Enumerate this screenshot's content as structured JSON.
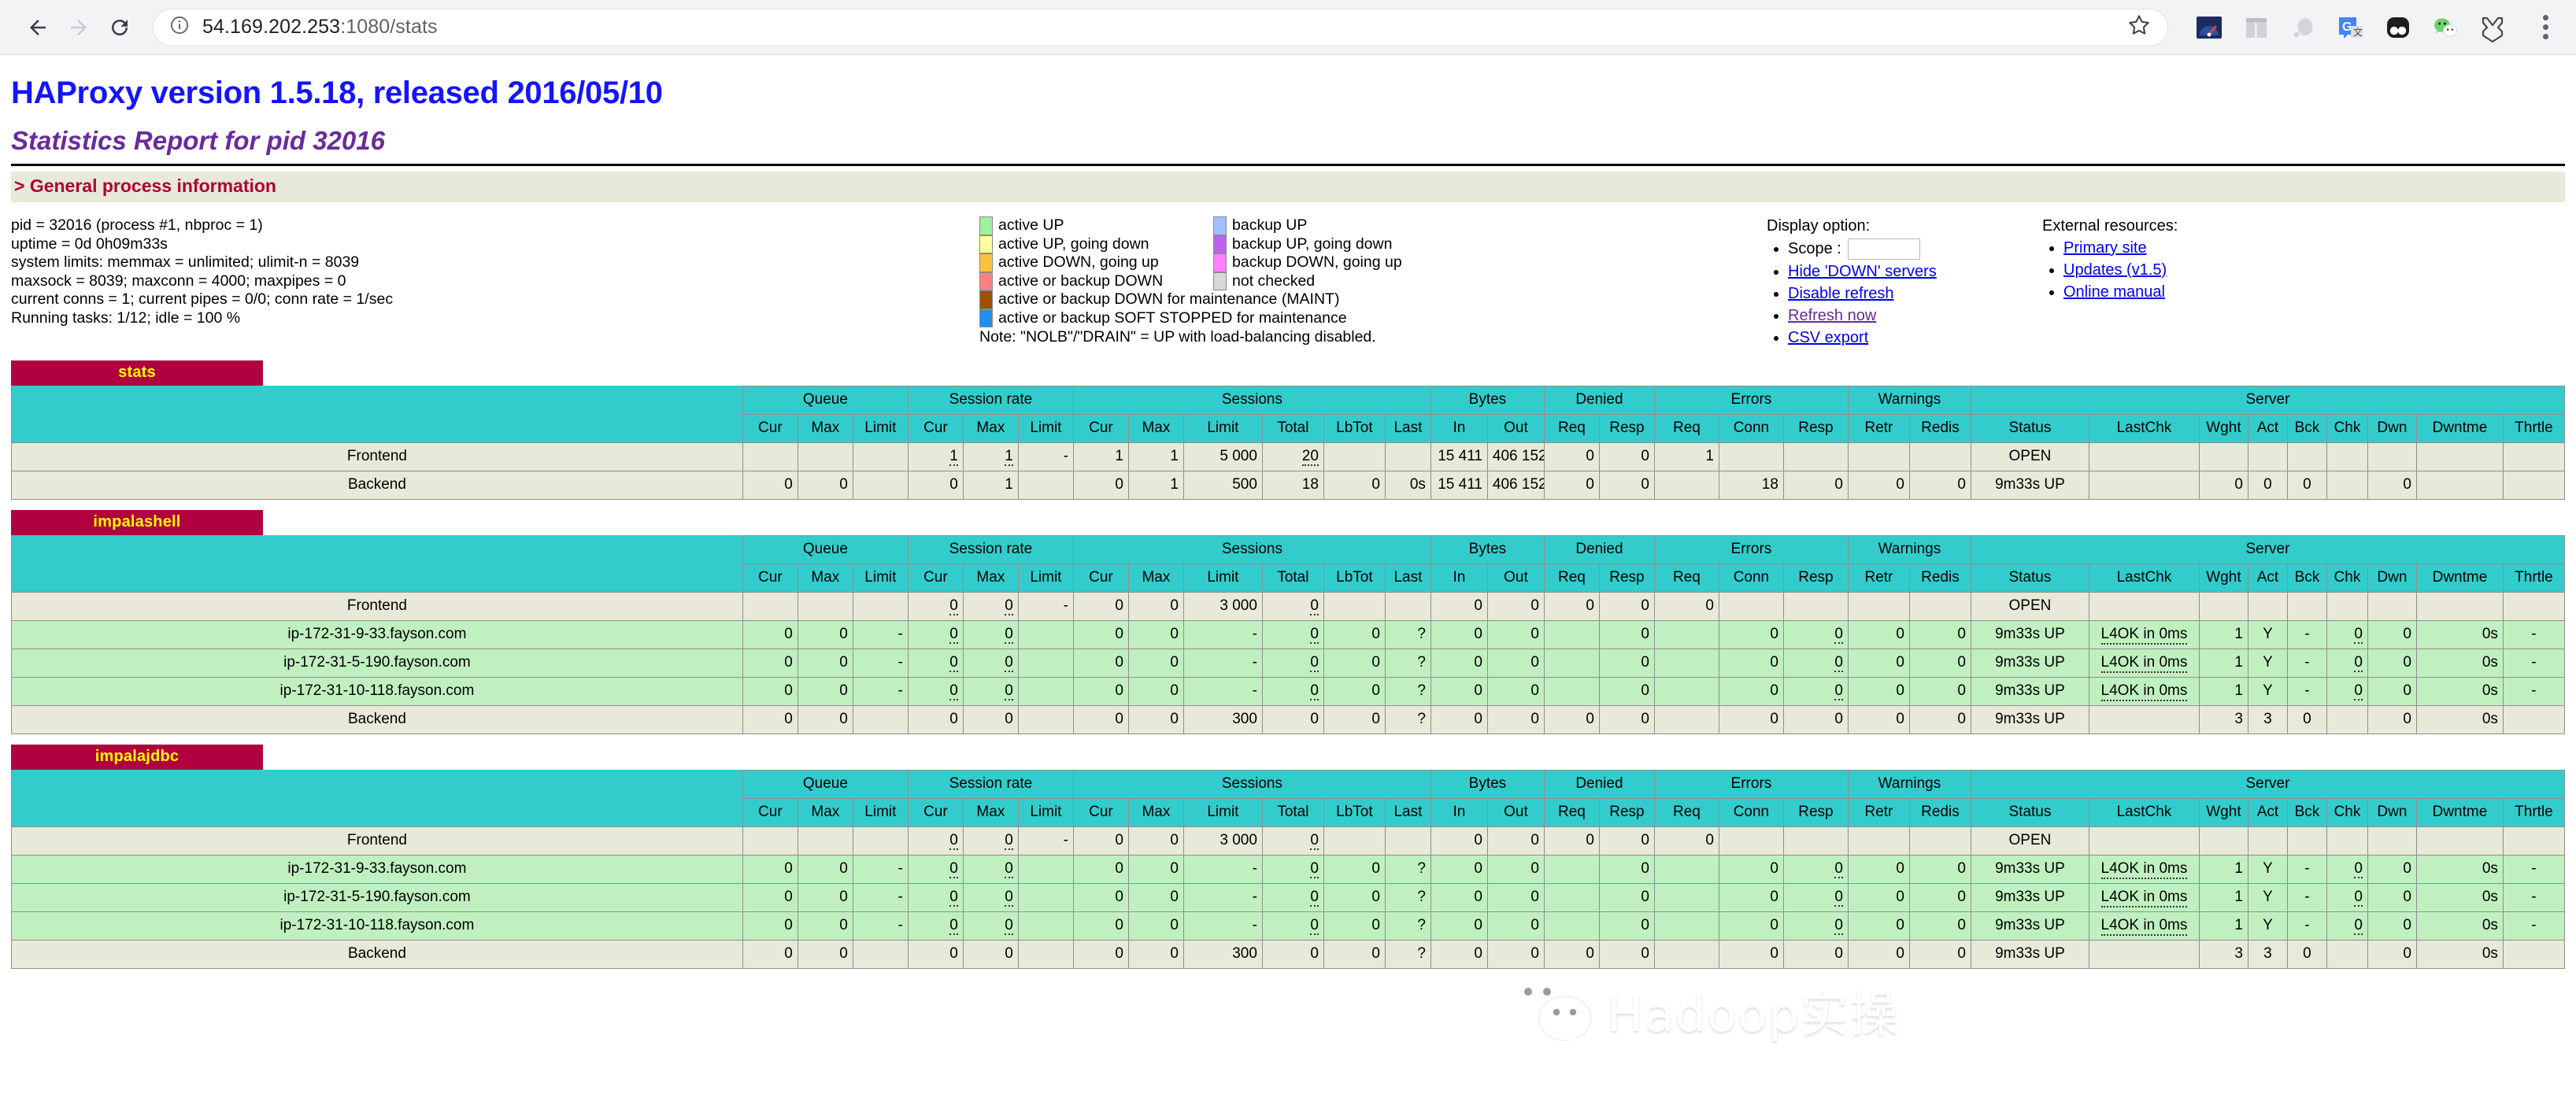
{
  "browser": {
    "url_host": "54.169.202.253",
    "url_path": ":1080/stats",
    "back_icon": "back-arrow-icon",
    "forward_icon": "forward-arrow-icon",
    "reload_icon": "reload-icon",
    "info_icon": "info-circle-icon",
    "bookmark_icon": "star-icon",
    "menu_icon": "kebab-menu-icon"
  },
  "header": {
    "title": "HAProxy version 1.5.18, released 2016/05/10",
    "subtitle": "Statistics Report for pid 32016",
    "section_title": "> General process information"
  },
  "process_info": [
    "pid = 32016 (process #1, nbproc = 1)",
    "uptime = 0d 0h09m33s",
    "system limits: memmax = unlimited; ulimit-n = 8039",
    "maxsock = 8039; maxconn = 4000; maxpipes = 0",
    "current conns = 1; current pipes = 0/0; conn rate = 1/sec",
    "Running tasks: 1/12; idle = 100 %"
  ],
  "legend": {
    "left": [
      {
        "label": "active UP",
        "color": "#a0f0a0"
      },
      {
        "label": "active UP, going down",
        "color": "#ffffa0"
      },
      {
        "label": "active DOWN, going up",
        "color": "#ffc040"
      },
      {
        "label": "active or backup DOWN",
        "color": "#ff8080"
      }
    ],
    "right": [
      {
        "label": "backup UP",
        "color": "#a0c0ff"
      },
      {
        "label": "backup UP, going down",
        "color": "#c060f0"
      },
      {
        "label": "backup DOWN, going up",
        "color": "#ff80ff"
      },
      {
        "label": "not checked",
        "color": "#d8d8d8"
      }
    ],
    "wide": [
      {
        "label": "active or backup DOWN for maintenance (MAINT)",
        "color": "#a05000"
      },
      {
        "label": "active or backup SOFT STOPPED for maintenance",
        "color": "#2090f0"
      }
    ],
    "note": "Note: \"NOLB\"/\"DRAIN\" = UP with load-balancing disabled."
  },
  "display_options": {
    "heading": "Display option:",
    "scope_label": "Scope :",
    "scope_value": "",
    "links": [
      {
        "label": "Hide 'DOWN' servers",
        "visited": false
      },
      {
        "label": "Disable refresh",
        "visited": false
      },
      {
        "label": "Refresh now",
        "visited": true
      },
      {
        "label": "CSV export",
        "visited": false
      }
    ]
  },
  "external_resources": {
    "heading": "External resources:",
    "links": [
      "Primary site",
      "Updates (v1.5)",
      "Online manual"
    ]
  },
  "table_headers": {
    "groups": [
      "Queue",
      "Session rate",
      "Sessions",
      "Bytes",
      "Denied",
      "Errors",
      "Warnings",
      "Server"
    ],
    "queue": [
      "Cur",
      "Max",
      "Limit"
    ],
    "session_rate": [
      "Cur",
      "Max",
      "Limit"
    ],
    "sessions": [
      "Cur",
      "Max",
      "Limit",
      "Total",
      "LbTot",
      "Last"
    ],
    "bytes": [
      "In",
      "Out"
    ],
    "denied": [
      "Req",
      "Resp"
    ],
    "errors": [
      "Req",
      "Conn",
      "Resp"
    ],
    "warnings": [
      "Retr",
      "Redis"
    ],
    "server": [
      "Status",
      "LastChk",
      "Wght",
      "Act",
      "Bck",
      "Chk",
      "Dwn",
      "Dwntme",
      "Thrtle"
    ]
  },
  "proxies": [
    {
      "name": "stats",
      "rows": [
        {
          "type": "frontend",
          "name": "Frontend",
          "q_cur": "",
          "q_max": "",
          "q_limit": "",
          "sr_cur": "1",
          "sr_max": "1",
          "sr_limit": "-",
          "s_cur": "1",
          "s_max": "1",
          "s_limit": "5 000",
          "s_total": "20",
          "s_lbtot": "",
          "s_last": "",
          "b_in": "15 411",
          "b_out": "406 152",
          "d_req": "0",
          "d_resp": "0",
          "e_req": "1",
          "e_conn": "",
          "e_resp": "",
          "w_retr": "",
          "w_redis": "",
          "status": "OPEN",
          "lastchk": "",
          "wght": "",
          "act": "",
          "bck": "",
          "chk": "",
          "dwn": "",
          "dwntme": "",
          "thrtle": ""
        },
        {
          "type": "backend",
          "name": "Backend",
          "q_cur": "0",
          "q_max": "0",
          "q_limit": "",
          "sr_cur": "0",
          "sr_max": "1",
          "sr_limit": "",
          "s_cur": "0",
          "s_max": "1",
          "s_limit": "500",
          "s_total": "18",
          "s_lbtot": "0",
          "s_last": "0s",
          "b_in": "15 411",
          "b_out": "406 152",
          "d_req": "0",
          "d_resp": "0",
          "e_req": "",
          "e_conn": "18",
          "e_resp": "0",
          "w_retr": "0",
          "w_redis": "0",
          "status": "9m33s UP",
          "lastchk": "",
          "wght": "0",
          "act": "0",
          "bck": "0",
          "chk": "",
          "dwn": "0",
          "dwntme": "",
          "thrtle": ""
        }
      ]
    },
    {
      "name": "impalashell",
      "rows": [
        {
          "type": "frontend",
          "name": "Frontend",
          "q_cur": "",
          "q_max": "",
          "q_limit": "",
          "sr_cur": "0",
          "sr_max": "0",
          "sr_limit": "-",
          "s_cur": "0",
          "s_max": "0",
          "s_limit": "3 000",
          "s_total": "0",
          "s_lbtot": "",
          "s_last": "",
          "b_in": "0",
          "b_out": "0",
          "d_req": "0",
          "d_resp": "0",
          "e_req": "0",
          "e_conn": "",
          "e_resp": "",
          "w_retr": "",
          "w_redis": "",
          "status": "OPEN",
          "lastchk": "",
          "wght": "",
          "act": "",
          "bck": "",
          "chk": "",
          "dwn": "",
          "dwntme": "",
          "thrtle": ""
        },
        {
          "type": "server",
          "name": "ip-172-31-9-33.fayson.com",
          "q_cur": "0",
          "q_max": "0",
          "q_limit": "-",
          "sr_cur": "0",
          "sr_max": "0",
          "sr_limit": "",
          "s_cur": "0",
          "s_max": "0",
          "s_limit": "-",
          "s_total": "0",
          "s_lbtot": "0",
          "s_last": "?",
          "b_in": "0",
          "b_out": "0",
          "d_req": "",
          "d_resp": "0",
          "e_req": "",
          "e_conn": "0",
          "e_resp": "0",
          "w_retr": "0",
          "w_redis": "0",
          "status": "9m33s UP",
          "lastchk": "L4OK in 0ms",
          "wght": "1",
          "act": "Y",
          "bck": "-",
          "chk": "0",
          "dwn": "0",
          "dwntme": "0s",
          "thrtle": "-"
        },
        {
          "type": "server",
          "name": "ip-172-31-5-190.fayson.com",
          "q_cur": "0",
          "q_max": "0",
          "q_limit": "-",
          "sr_cur": "0",
          "sr_max": "0",
          "sr_limit": "",
          "s_cur": "0",
          "s_max": "0",
          "s_limit": "-",
          "s_total": "0",
          "s_lbtot": "0",
          "s_last": "?",
          "b_in": "0",
          "b_out": "0",
          "d_req": "",
          "d_resp": "0",
          "e_req": "",
          "e_conn": "0",
          "e_resp": "0",
          "w_retr": "0",
          "w_redis": "0",
          "status": "9m33s UP",
          "lastchk": "L4OK in 0ms",
          "wght": "1",
          "act": "Y",
          "bck": "-",
          "chk": "0",
          "dwn": "0",
          "dwntme": "0s",
          "thrtle": "-"
        },
        {
          "type": "server",
          "name": "ip-172-31-10-118.fayson.com",
          "q_cur": "0",
          "q_max": "0",
          "q_limit": "-",
          "sr_cur": "0",
          "sr_max": "0",
          "sr_limit": "",
          "s_cur": "0",
          "s_max": "0",
          "s_limit": "-",
          "s_total": "0",
          "s_lbtot": "0",
          "s_last": "?",
          "b_in": "0",
          "b_out": "0",
          "d_req": "",
          "d_resp": "0",
          "e_req": "",
          "e_conn": "0",
          "e_resp": "0",
          "w_retr": "0",
          "w_redis": "0",
          "status": "9m33s UP",
          "lastchk": "L4OK in 0ms",
          "wght": "1",
          "act": "Y",
          "bck": "-",
          "chk": "0",
          "dwn": "0",
          "dwntme": "0s",
          "thrtle": "-"
        },
        {
          "type": "backend",
          "name": "Backend",
          "q_cur": "0",
          "q_max": "0",
          "q_limit": "",
          "sr_cur": "0",
          "sr_max": "0",
          "sr_limit": "",
          "s_cur": "0",
          "s_max": "0",
          "s_limit": "300",
          "s_total": "0",
          "s_lbtot": "0",
          "s_last": "?",
          "b_in": "0",
          "b_out": "0",
          "d_req": "0",
          "d_resp": "0",
          "e_req": "",
          "e_conn": "0",
          "e_resp": "0",
          "w_retr": "0",
          "w_redis": "0",
          "status": "9m33s UP",
          "lastchk": "",
          "wght": "3",
          "act": "3",
          "bck": "0",
          "chk": "",
          "dwn": "0",
          "dwntme": "0s",
          "thrtle": ""
        }
      ]
    },
    {
      "name": "impalajdbc",
      "rows": [
        {
          "type": "frontend",
          "name": "Frontend",
          "q_cur": "",
          "q_max": "",
          "q_limit": "",
          "sr_cur": "0",
          "sr_max": "0",
          "sr_limit": "-",
          "s_cur": "0",
          "s_max": "0",
          "s_limit": "3 000",
          "s_total": "0",
          "s_lbtot": "",
          "s_last": "",
          "b_in": "0",
          "b_out": "0",
          "d_req": "0",
          "d_resp": "0",
          "e_req": "0",
          "e_conn": "",
          "e_resp": "",
          "w_retr": "",
          "w_redis": "",
          "status": "OPEN",
          "lastchk": "",
          "wght": "",
          "act": "",
          "bck": "",
          "chk": "",
          "dwn": "",
          "dwntme": "",
          "thrtle": ""
        },
        {
          "type": "server",
          "name": "ip-172-31-9-33.fayson.com",
          "q_cur": "0",
          "q_max": "0",
          "q_limit": "-",
          "sr_cur": "0",
          "sr_max": "0",
          "sr_limit": "",
          "s_cur": "0",
          "s_max": "0",
          "s_limit": "-",
          "s_total": "0",
          "s_lbtot": "0",
          "s_last": "?",
          "b_in": "0",
          "b_out": "0",
          "d_req": "",
          "d_resp": "0",
          "e_req": "",
          "e_conn": "0",
          "e_resp": "0",
          "w_retr": "0",
          "w_redis": "0",
          "status": "9m33s UP",
          "lastchk": "L4OK in 0ms",
          "wght": "1",
          "act": "Y",
          "bck": "-",
          "chk": "0",
          "dwn": "0",
          "dwntme": "0s",
          "thrtle": "-"
        },
        {
          "type": "server",
          "name": "ip-172-31-5-190.fayson.com",
          "q_cur": "0",
          "q_max": "0",
          "q_limit": "-",
          "sr_cur": "0",
          "sr_max": "0",
          "sr_limit": "",
          "s_cur": "0",
          "s_max": "0",
          "s_limit": "-",
          "s_total": "0",
          "s_lbtot": "0",
          "s_last": "?",
          "b_in": "0",
          "b_out": "0",
          "d_req": "",
          "d_resp": "0",
          "e_req": "",
          "e_conn": "0",
          "e_resp": "0",
          "w_retr": "0",
          "w_redis": "0",
          "status": "9m33s UP",
          "lastchk": "L4OK in 0ms",
          "wght": "1",
          "act": "Y",
          "bck": "-",
          "chk": "0",
          "dwn": "0",
          "dwntme": "0s",
          "thrtle": "-"
        },
        {
          "type": "server",
          "name": "ip-172-31-10-118.fayson.com",
          "q_cur": "0",
          "q_max": "0",
          "q_limit": "-",
          "sr_cur": "0",
          "sr_max": "0",
          "sr_limit": "",
          "s_cur": "0",
          "s_max": "0",
          "s_limit": "-",
          "s_total": "0",
          "s_lbtot": "0",
          "s_last": "?",
          "b_in": "0",
          "b_out": "0",
          "d_req": "",
          "d_resp": "0",
          "e_req": "",
          "e_conn": "0",
          "e_resp": "0",
          "w_retr": "0",
          "w_redis": "0",
          "status": "9m33s UP",
          "lastchk": "L4OK in 0ms",
          "wght": "1",
          "act": "Y",
          "bck": "-",
          "chk": "0",
          "dwn": "0",
          "dwntme": "0s",
          "thrtle": "-"
        },
        {
          "type": "backend",
          "name": "Backend",
          "q_cur": "0",
          "q_max": "0",
          "q_limit": "",
          "sr_cur": "0",
          "sr_max": "0",
          "sr_limit": "",
          "s_cur": "0",
          "s_max": "0",
          "s_limit": "300",
          "s_total": "0",
          "s_lbtot": "0",
          "s_last": "?",
          "b_in": "0",
          "b_out": "0",
          "d_req": "0",
          "d_resp": "0",
          "e_req": "",
          "e_conn": "0",
          "e_resp": "0",
          "w_retr": "0",
          "w_redis": "0",
          "status": "9m33s UP",
          "lastchk": "",
          "wght": "3",
          "act": "3",
          "bck": "0",
          "chk": "",
          "dwn": "0",
          "dwntme": "0s",
          "thrtle": ""
        }
      ]
    }
  ],
  "watermark": {
    "text": "Hadoop实操",
    "logo": "wechat-logo"
  }
}
